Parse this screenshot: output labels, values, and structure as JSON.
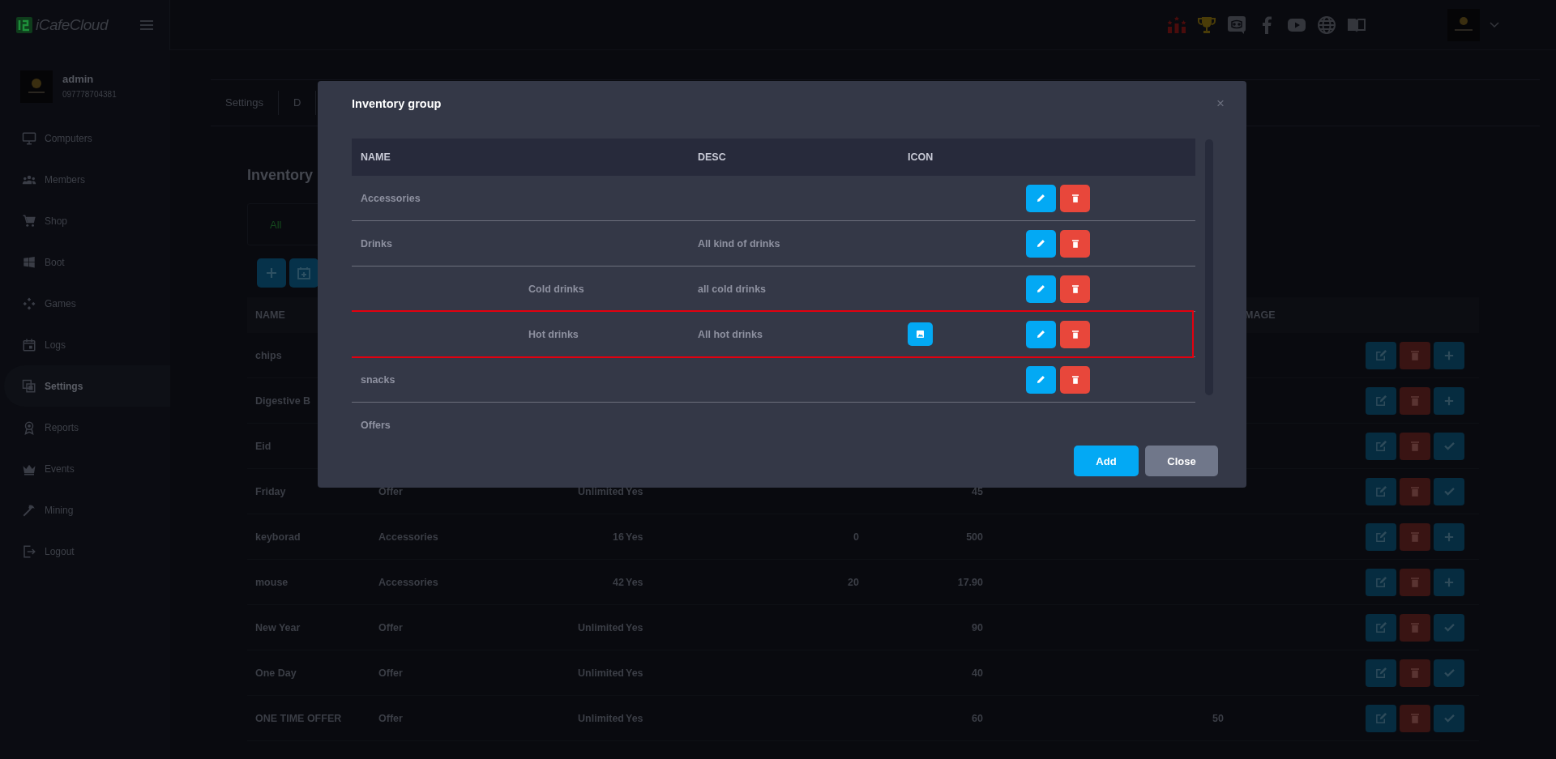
{
  "app": {
    "name": "iCafeCloud"
  },
  "user": {
    "name": "admin",
    "phone": "097778704381"
  },
  "sidebar": {
    "items": [
      {
        "label": "Computers",
        "selected": false
      },
      {
        "label": "Members",
        "selected": false
      },
      {
        "label": "Shop",
        "selected": false
      },
      {
        "label": "Boot",
        "selected": false
      },
      {
        "label": "Games",
        "selected": false
      },
      {
        "label": "Logs",
        "selected": false
      },
      {
        "label": "Settings",
        "selected": true
      },
      {
        "label": "Reports",
        "selected": false
      },
      {
        "label": "Events",
        "selected": false
      },
      {
        "label": "Mining",
        "selected": false
      },
      {
        "label": "Logout",
        "selected": false
      }
    ]
  },
  "page": {
    "tabs": [
      {
        "label": "Settings",
        "selected": false
      },
      {
        "label": "D",
        "selected": false
      }
    ],
    "title": "Inventory",
    "filters": [
      {
        "label": "All",
        "selected": true
      }
    ],
    "table": {
      "columns": [
        "NAME",
        "MAGE"
      ],
      "rows": [
        {
          "name": "chips",
          "kind": "add"
        },
        {
          "name": "Digestive B",
          "kind": "add"
        },
        {
          "name": "Eid",
          "kind": "confirm"
        },
        {
          "name": "Friday",
          "category": "Offer",
          "quantity": "Unlimited",
          "active": "Yes",
          "price": "45",
          "kind": "confirm"
        },
        {
          "name": "keyborad",
          "category": "Accessories",
          "quantity": "16",
          "active": "Yes",
          "column_5": "0",
          "price": "500",
          "kind": "add"
        },
        {
          "name": "mouse",
          "category": "Accessories",
          "quantity": "42",
          "active": "Yes",
          "column_5": "20",
          "price": "17.90",
          "kind": "add"
        },
        {
          "name": "New Year",
          "category": "Offer",
          "quantity": "Unlimited",
          "active": "Yes",
          "price": "90",
          "kind": "confirm"
        },
        {
          "name": "One Day",
          "category": "Offer",
          "quantity": "Unlimited",
          "active": "Yes",
          "price": "40",
          "kind": "confirm"
        },
        {
          "name": "ONE TIME OFFER",
          "category": "Offer",
          "quantity": "Unlimited",
          "active": "Yes",
          "price": "60",
          "image": "50",
          "kind": "confirm"
        }
      ]
    }
  },
  "modal": {
    "title": "Inventory group",
    "close": "×",
    "columns": [
      "NAME",
      "DESC",
      "ICON"
    ],
    "groups": [
      {
        "name": "Accessories",
        "has_icon": false,
        "highlighted": false,
        "editable": true
      },
      {
        "name": "Drinks",
        "desc": "All kind of drinks",
        "has_icon": false,
        "highlighted": false,
        "editable": true,
        "children": [
          {
            "name": "Cold drinks",
            "desc": "all cold drinks",
            "has_icon": false,
            "highlighted": false,
            "editable": true
          },
          {
            "name": "Hot drinks",
            "desc": "All hot drinks",
            "has_icon": true,
            "highlighted": true,
            "editable": true
          }
        ]
      },
      {
        "name": "snacks",
        "has_icon": false,
        "highlighted": false,
        "editable": true
      },
      {
        "name": "Offers",
        "has_icon": false,
        "highlighted": false,
        "editable": false
      }
    ],
    "buttons": [
      {
        "label": "Add",
        "kind": "primary"
      },
      {
        "label": "Close",
        "kind": "secondary"
      }
    ]
  }
}
